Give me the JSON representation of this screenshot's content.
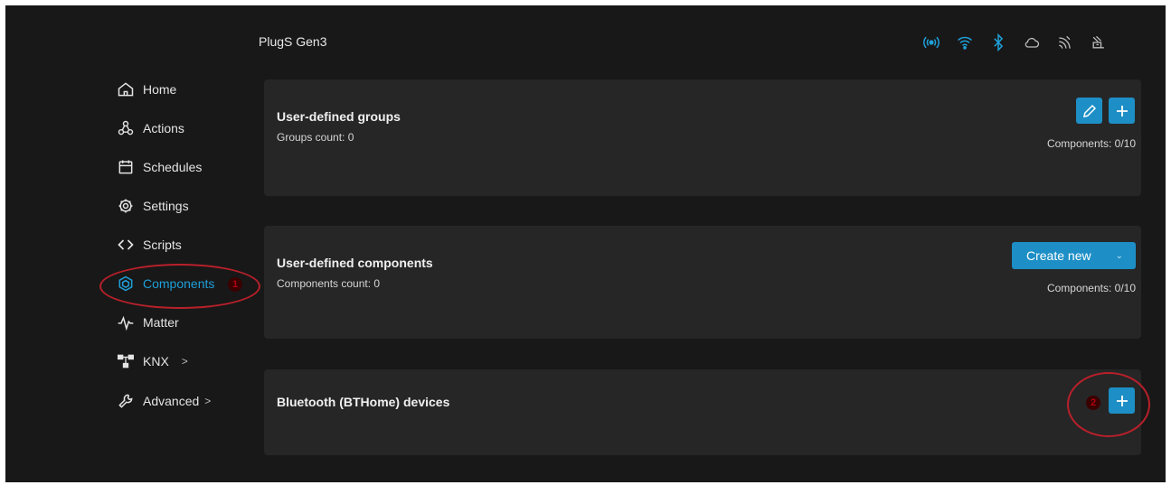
{
  "device": {
    "title": "PlugS Gen3"
  },
  "status_icons": [
    {
      "name": "signal-broadcast-icon"
    },
    {
      "name": "wifi-icon"
    },
    {
      "name": "bluetooth-icon"
    },
    {
      "name": "cloud-icon"
    },
    {
      "name": "mqtt-icon"
    },
    {
      "name": "websocket-icon"
    }
  ],
  "sidebar": {
    "items": [
      {
        "label": "Home",
        "icon": "home-icon"
      },
      {
        "label": "Actions",
        "icon": "actions-icon"
      },
      {
        "label": "Schedules",
        "icon": "calendar-icon"
      },
      {
        "label": "Settings",
        "icon": "gear-icon"
      },
      {
        "label": "Scripts",
        "icon": "code-icon"
      },
      {
        "label": "Components",
        "icon": "components-icon",
        "active": true
      },
      {
        "label": "Matter",
        "icon": "matter-icon"
      },
      {
        "label": "KNX",
        "icon": "knx-icon",
        "expand": ">"
      },
      {
        "label": "Advanced",
        "icon": "wrench-icon",
        "expand": ">"
      }
    ]
  },
  "annotations": {
    "marker_1": "1",
    "marker_2": "2"
  },
  "groups": {
    "title": "User-defined groups",
    "count_label": "Groups count: 0",
    "components_label": "Components: 0/10"
  },
  "components": {
    "title": "User-defined components",
    "count_label": "Components count: 0",
    "components_label": "Components: 0/10",
    "create_label": "Create new"
  },
  "bluetooth": {
    "title": "Bluetooth (BTHome) devices"
  },
  "colors": {
    "accent": "#1d8fc6",
    "active_text": "#1f9fd9",
    "annotation": "#b8202a",
    "background": "#181818",
    "card": "#262626"
  }
}
